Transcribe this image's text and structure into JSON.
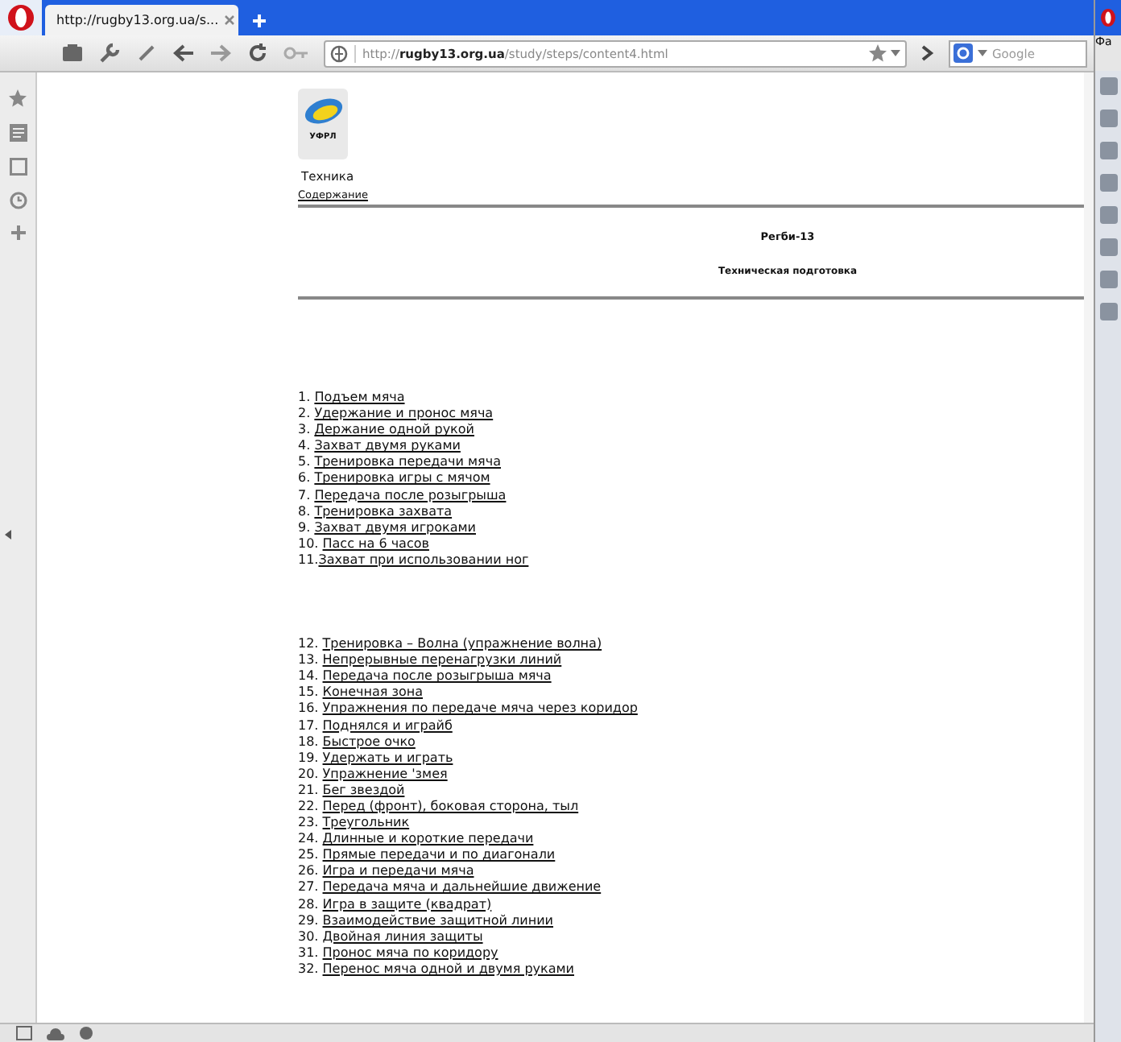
{
  "browser": {
    "tab_title": "http://rugby13.org.ua/s...",
    "address": "http://**rugby13.org.ua**/study/steps/content4.html",
    "search_placeholder": "Google",
    "side_window_label": "Фа"
  },
  "page": {
    "logo_text": "УФРЛ",
    "title": "Техника",
    "contents_link": "Содержание",
    "heading": "Регби-13",
    "subheading": "Техническая подготовка",
    "groups": [
      [
        {
          "number": "1. ",
          "label": "Подъем мяча"
        },
        {
          "number": "2. ",
          "label": "Удержание и пронос мяча"
        },
        {
          "number": "3. ",
          "label": "Держание одной рукой"
        },
        {
          "number": "4. ",
          "label": "Захват двумя руками"
        },
        {
          "number": "5. ",
          "label": "Тренировка передачи мяча"
        },
        {
          "number": "6. ",
          "label": "Тренировка игры с мячом"
        },
        {
          "number": "7. ",
          "label": "Передача после розыгрыша"
        },
        {
          "number": "8. ",
          "label": "Тренировка захвата"
        },
        {
          "number": "9. ",
          "label": "Захват двумя игроками"
        },
        {
          "number": "10. ",
          "label": "Пасс на 6 часов"
        },
        {
          "number": "11.",
          "label": "Захват при использовании ног"
        }
      ],
      [
        {
          "number": "12. ",
          "label": "Тренировка – Волна (упражнение волна)"
        },
        {
          "number": "13. ",
          "label": "Непрерывные перенагрузки линий"
        },
        {
          "number": "14. ",
          "label": "Передача после розыгрыша мяча"
        },
        {
          "number": "15. ",
          "label": "Конечная зона"
        },
        {
          "number": "16. ",
          "label": "Упражнения по передаче мяча через коридор"
        },
        {
          "number": "17. ",
          "label": "Поднялся и играйб"
        },
        {
          "number": "18. ",
          "label": "Быстрое очко"
        },
        {
          "number": "19. ",
          "label": "Удержать и играть"
        },
        {
          "number": "20. ",
          "label": "Упражнение 'змея"
        },
        {
          "number": "21. ",
          "label": "Бег звездой"
        },
        {
          "number": "22. ",
          "label": "Перед (фронт), боковая сторона, тыл"
        },
        {
          "number": "23. ",
          "label": "Треугольник"
        },
        {
          "number": "24. ",
          "label": "Длинные и короткие передачи"
        },
        {
          "number": "25. ",
          "label": "Прямые передачи и по диагонали"
        },
        {
          "number": "26. ",
          "label": "Игра и передачи мяча"
        },
        {
          "number": "27. ",
          "label": "Передача мяча и дальнейшие движение"
        },
        {
          "number": "28. ",
          "label": "Игра в защите (квадрат)"
        },
        {
          "number": "29. ",
          "label": "Взаимодействие защитной линии"
        },
        {
          "number": "30. ",
          "label": "Двойная линия защиты"
        },
        {
          "number": "31. ",
          "label": "Пронос мяча по коридору"
        },
        {
          "number": "32. ",
          "label": "Перенос мяча одной и двумя руками"
        }
      ]
    ]
  }
}
